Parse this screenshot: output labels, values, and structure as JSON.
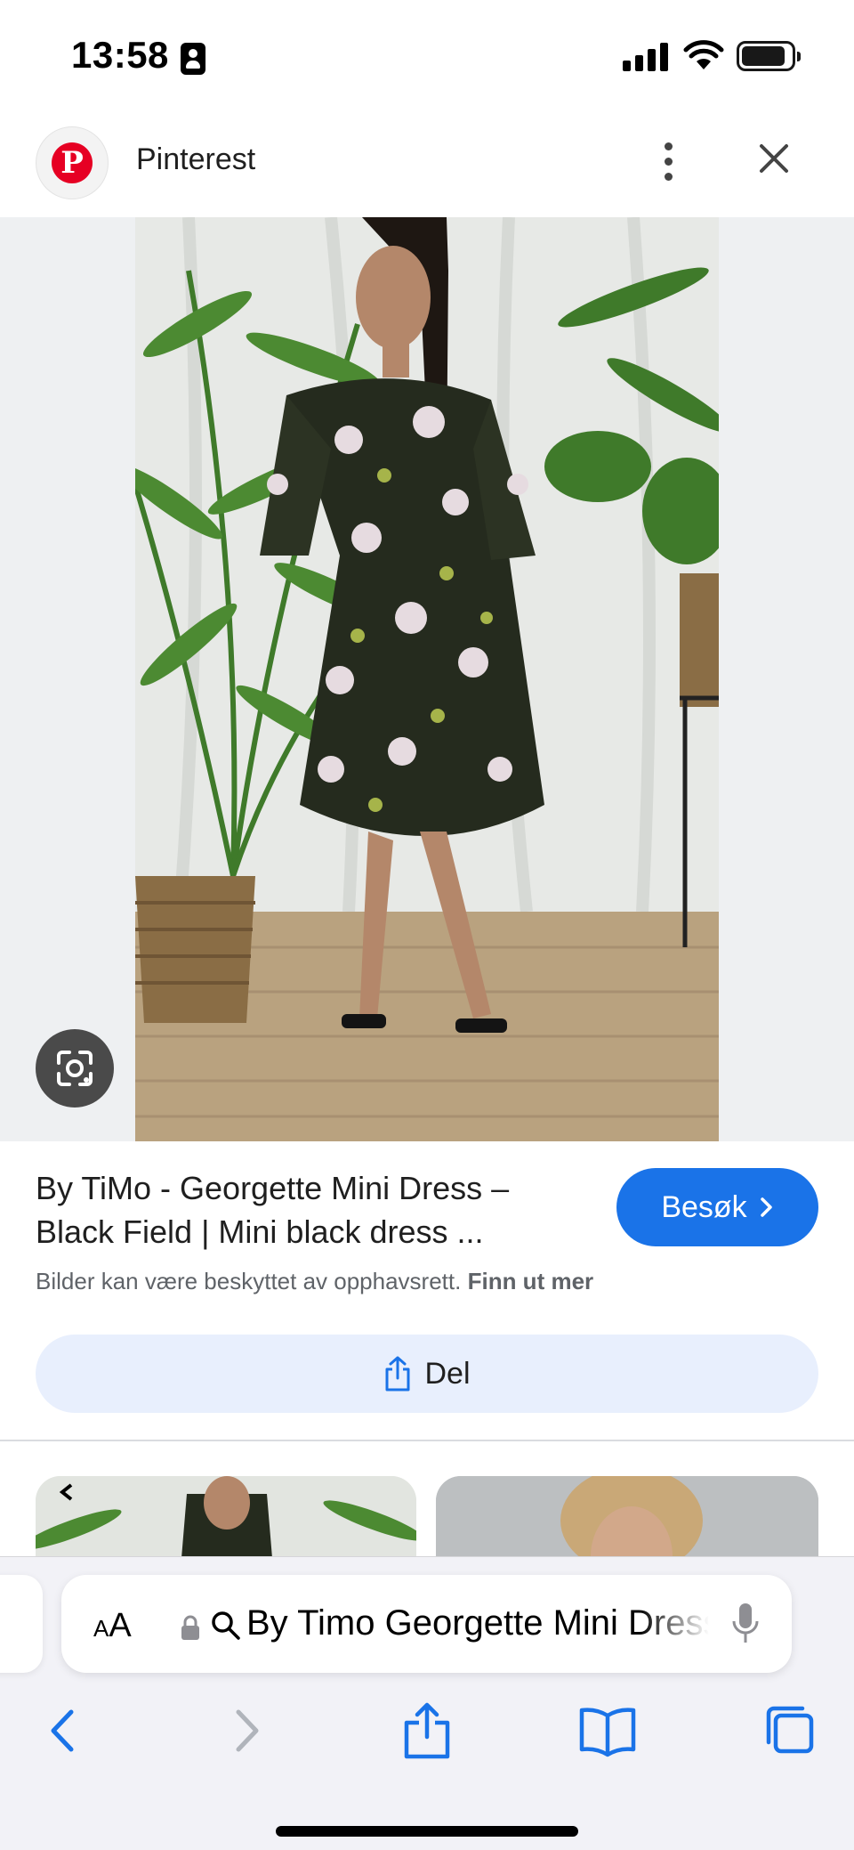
{
  "status_bar": {
    "time": "13:58"
  },
  "header": {
    "site_name": "Pinterest"
  },
  "pin": {
    "title": "By TiMo - Georgette Mini Dress – Black Field | Mini black dress ...",
    "visit_label": "Besøk",
    "copyright_text": "Bilder kan være beskyttet av opphavsrett.",
    "copyright_link": "Finn ut mer",
    "share_label": "Del"
  },
  "safari": {
    "text_size_label": "AA",
    "url": "By Timo Georgette Mini Dress"
  },
  "colors": {
    "accent_blue": "#1a73e8",
    "share_bg": "#e8effd",
    "pinterest_red": "#e60023"
  },
  "icons": [
    "pinterest-logo",
    "more-vert-icon",
    "close-icon",
    "lens-icon",
    "chevron-right-icon",
    "share-icon",
    "lock-icon",
    "search-icon",
    "mic-icon",
    "back-icon",
    "forward-icon",
    "bookmarks-icon",
    "tabs-icon"
  ]
}
